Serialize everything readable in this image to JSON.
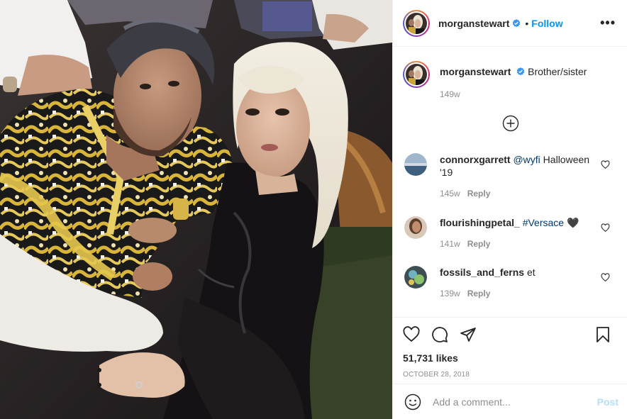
{
  "post": {
    "author": "morganstewart",
    "follow_label": "Follow",
    "dot": "•",
    "more_label": "•••"
  },
  "caption": {
    "user": "morganstewart",
    "text": "Brother/sister",
    "time": "149w"
  },
  "comments": [
    {
      "user": "connorxgarrett",
      "mention": "@wyfi",
      "text": " Halloween '19",
      "time": "145w",
      "reply": "Reply"
    },
    {
      "user": "flourishingpetal_",
      "mention": "#Versace",
      "text": " 🖤",
      "time": "141w",
      "reply": "Reply"
    },
    {
      "user": "fossils_and_ferns",
      "mention": "",
      "text": "et",
      "time": "139w",
      "reply": "Reply"
    }
  ],
  "stats": {
    "likes": "51,731 likes",
    "date": "October 28, 2018"
  },
  "composer": {
    "placeholder": "Add a comment...",
    "post_label": "Post"
  },
  "icons": {
    "verified": "verified-badge-icon",
    "like": "heart-icon",
    "comment": "comment-bubble-icon",
    "share": "paper-plane-icon",
    "save": "bookmark-icon",
    "emoji": "smiley-icon",
    "load_more": "plus-circle-icon",
    "more": "ellipsis-icon"
  },
  "colors": {
    "link_blue": "#0095f6",
    "post_disabled": "#b2dffc",
    "verified": "#3897f0",
    "muted": "#8e8e8e"
  }
}
